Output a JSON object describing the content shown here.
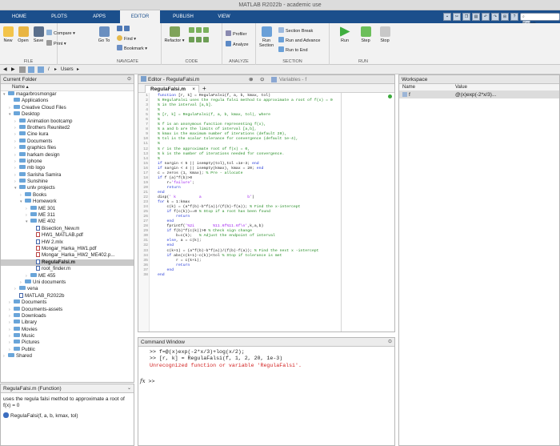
{
  "window": {
    "title": "MATLAB R2022b - academic use"
  },
  "tabs": [
    "HOME",
    "PLOTS",
    "APPS",
    "EDITOR",
    "PUBLISH",
    "VIEW"
  ],
  "search_placeholder": "Search",
  "ribbon": {
    "file": {
      "name": "FILE",
      "new": "New",
      "open": "Open",
      "save": "Save",
      "compare": "Compare",
      "print": "Print"
    },
    "navigate": {
      "name": "NAVIGATE",
      "goto": "Go To",
      "find": "Find",
      "bookmark": "Bookmark"
    },
    "code": {
      "name": "CODE",
      "refactor": "Refactor"
    },
    "analyze": {
      "name": "ANALYZE",
      "profiler": "Profiler",
      "analyze": "Analyze"
    },
    "section": {
      "name": "SECTION",
      "run_section": "Run Section",
      "section_break": "Section Break",
      "run_advance": "Run and Advance",
      "run_end": "Run to End"
    },
    "run": {
      "name": "RUN",
      "run": "Run",
      "step": "Step",
      "stop": "Stop"
    }
  },
  "address": {
    "separator": "/",
    "folder": "Users"
  },
  "current_folder": {
    "title": "Current Folder",
    "col_name": "Name",
    "items": [
      {
        "label": "magarbrosmongar",
        "depth": 0,
        "kind": "folder",
        "arrow": "▾"
      },
      {
        "label": "Applications",
        "depth": 1,
        "kind": "folder",
        "arrow": ""
      },
      {
        "label": "Creative Cloud Files",
        "depth": 1,
        "kind": "folder",
        "arrow": "›"
      },
      {
        "label": "Desktop",
        "depth": 1,
        "kind": "folder",
        "arrow": "▾"
      },
      {
        "label": "Animation bootcamp",
        "depth": 2,
        "kind": "folder",
        "arrow": "›"
      },
      {
        "label": "Brothers Reunited2",
        "depth": 2,
        "kind": "folder",
        "arrow": "›"
      },
      {
        "label": "Cine kura",
        "depth": 2,
        "kind": "folder",
        "arrow": "›"
      },
      {
        "label": "Documents",
        "depth": 2,
        "kind": "folder",
        "arrow": "›"
      },
      {
        "label": "graphics files",
        "depth": 2,
        "kind": "folder",
        "arrow": "›"
      },
      {
        "label": "harkam design",
        "depth": 2,
        "kind": "folder",
        "arrow": "›"
      },
      {
        "label": "iphone",
        "depth": 2,
        "kind": "folder",
        "arrow": "›"
      },
      {
        "label": "mb logo",
        "depth": 2,
        "kind": "folder",
        "arrow": "›"
      },
      {
        "label": "Sarisha Samira",
        "depth": 2,
        "kind": "folder",
        "arrow": "›"
      },
      {
        "label": "Sunshine",
        "depth": 2,
        "kind": "folder",
        "arrow": "›"
      },
      {
        "label": "unlv projects",
        "depth": 2,
        "kind": "folder",
        "arrow": "▾"
      },
      {
        "label": "Books",
        "depth": 3,
        "kind": "folder",
        "arrow": "›"
      },
      {
        "label": "Homework",
        "depth": 3,
        "kind": "folder",
        "arrow": "▾"
      },
      {
        "label": "ME 301",
        "depth": 4,
        "kind": "folder",
        "arrow": "›"
      },
      {
        "label": "ME 311",
        "depth": 4,
        "kind": "folder",
        "arrow": "›"
      },
      {
        "label": "ME 402",
        "depth": 4,
        "kind": "folder",
        "arrow": "▾"
      },
      {
        "label": "Bisection_New.m",
        "depth": 5,
        "kind": "mfile",
        "arrow": ""
      },
      {
        "label": "HW1_MATLAB.pdf",
        "depth": 5,
        "kind": "pdf",
        "arrow": ""
      },
      {
        "label": "HW 2.mlx",
        "depth": 5,
        "kind": "mfile",
        "arrow": ""
      },
      {
        "label": "Mongar_Harka_HW1.pdf",
        "depth": 5,
        "kind": "pdf",
        "arrow": ""
      },
      {
        "label": "Mongar_Harka_HW2_ME402.p...",
        "depth": 5,
        "kind": "pdf",
        "arrow": ""
      },
      {
        "label": "RegulaFalsi.m",
        "depth": 5,
        "kind": "mfile",
        "arrow": "",
        "selected": true
      },
      {
        "label": "root_finder.m",
        "depth": 5,
        "kind": "mfile",
        "arrow": ""
      },
      {
        "label": "ME 455",
        "depth": 4,
        "kind": "folder",
        "arrow": "›"
      },
      {
        "label": "Uni documents",
        "depth": 3,
        "kind": "folder",
        "arrow": "›"
      },
      {
        "label": "vena",
        "depth": 2,
        "kind": "folder",
        "arrow": "›"
      },
      {
        "label": "MATLAB_R2022b",
        "depth": 2,
        "kind": "mfile",
        "arrow": ""
      },
      {
        "label": "Documents",
        "depth": 1,
        "kind": "folder",
        "arrow": "›"
      },
      {
        "label": "Documents-assets",
        "depth": 1,
        "kind": "folder",
        "arrow": "›"
      },
      {
        "label": "Downloads",
        "depth": 1,
        "kind": "folder",
        "arrow": "›"
      },
      {
        "label": "Library",
        "depth": 1,
        "kind": "folder",
        "arrow": "›"
      },
      {
        "label": "Movies",
        "depth": 1,
        "kind": "folder",
        "arrow": "›"
      },
      {
        "label": "Music",
        "depth": 1,
        "kind": "folder",
        "arrow": "›"
      },
      {
        "label": "Pictures",
        "depth": 1,
        "kind": "folder",
        "arrow": "›"
      },
      {
        "label": "Public",
        "depth": 1,
        "kind": "folder",
        "arrow": "›"
      },
      {
        "label": "Shared",
        "depth": 0,
        "kind": "folder",
        "arrow": "›"
      }
    ]
  },
  "details": {
    "title": "RegulaFalsi.m (Function)",
    "description": "uses the regula falsi method to approximate a root of f(x) = 0",
    "signature": "RegulaFalsi(f, a, b, kmax, tol)"
  },
  "editor": {
    "title": "Editor - RegulaFalsi.m",
    "variables_title": "Variables - f",
    "file_tab": "RegulaFalsi.m",
    "lines": [
      "function [r, k] = RegulaFalsi(f, a, b, kmax, tol)",
      "% RegulaFalsi uses the regula falsi method to approximate a root of f(x) = 0",
      "% in the interval [a,b].",
      "%",
      "% [r, k] = RegulaFalsi(f, a, b, kmax, tol), where",
      "%",
      "% f is an anonymous function representing f(x),",
      "% a and b are the limits of interval [a,b],",
      "% kmax is the maximum number of iterations (default 20),",
      "% tol is the scalar tolerance for convergence (default 1e-4),",
      "%",
      "% r is the approximate root of f(x) = 0,",
      "% k is the number of iterations needed for convergence.",
      "%",
      "if nargin < 5 || isempty(tol),tol =1e-3; end",
      "if nargin < 4 || isempty(kmax), kmax = 20; end",
      "c = zeros (1, kmax); % Pre - allocate",
      "if f (a)*f(b)>0",
      "    r='failure';",
      "    return",
      "end",
      "disp(' k          a                    b')",
      "for k = 1:kmax",
      "    c(k) = (a*f(b)-b*f(a))/(f(b)-f(a)); % Find the x-intercept",
      "    if f(c(k))==0 % Stop if a root has been found",
      "        return",
      "    end",
      "    fprintf('%2i        %11.6f%11.6f\\n',k,a,b)",
      "    if f(b)*f(c(k))>0 % Check sign change",
      "        b=c(k);   % Adjust the endpoint of interval",
      "    else, a = c(k);",
      "    end",
      "    c(k+1) = (a*f(b)-b*f(a))/(f(b)-f(a)); % Find the next x -intercept",
      "    if abs(c(k+1)-c(k))<tol % Stop if tolerance is met",
      "        r = c(k+1);",
      "        return",
      "    end",
      "end"
    ]
  },
  "command_window": {
    "title": "Command Window",
    "lines": [
      {
        "prompt": ">>",
        "text": "f=@(x)exp(-2*x/3)+log(x/2);",
        "type": "input"
      },
      {
        "prompt": ">>",
        "text": "[r, k] = RegulaFalsi(f, 1, 2, 20, 1e-3)",
        "type": "input"
      },
      {
        "prompt": "",
        "text": "Unrecognized function or variable 'RegulaFalsi'.",
        "type": "error"
      }
    ],
    "fx": "fx",
    "current_prompt": ">>"
  },
  "workspace": {
    "title": "Workspace",
    "col_name": "Name",
    "col_value": "Value",
    "rows": [
      {
        "name": "f",
        "value": "@(x)exp(-2*x/3)..."
      }
    ]
  }
}
